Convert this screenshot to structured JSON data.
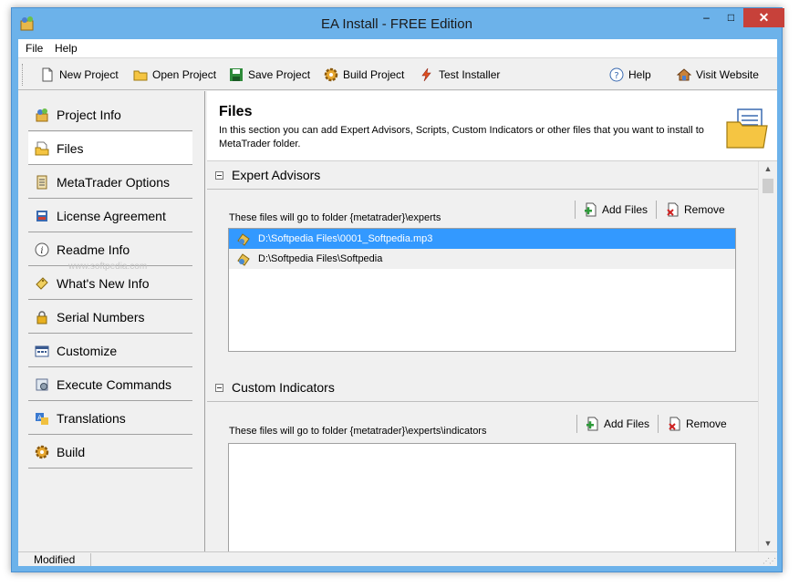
{
  "window": {
    "title": "EA Install - FREE Edition",
    "min_symbol": "–",
    "max_symbol": "□",
    "close_symbol": "✕"
  },
  "menu": {
    "items": [
      "File",
      "Help"
    ]
  },
  "toolbar": {
    "new_project": "New Project",
    "open_project": "Open Project",
    "save_project": "Save Project",
    "build_project": "Build Project",
    "test_installer": "Test Installer",
    "help": "Help",
    "visit_website": "Visit Website"
  },
  "sidebar": {
    "items": [
      {
        "label": "Project Info",
        "icon": "project-info-icon",
        "active": false
      },
      {
        "label": "Files",
        "icon": "files-icon",
        "active": true
      },
      {
        "label": "MetaTrader Options",
        "icon": "options-icon",
        "active": false
      },
      {
        "label": "License Agreement",
        "icon": "license-icon",
        "active": false
      },
      {
        "label": "Readme Info",
        "icon": "info-icon",
        "active": false
      },
      {
        "label": "What's New Info",
        "icon": "whats-new-icon",
        "active": false
      },
      {
        "label": "Serial Numbers",
        "icon": "lock-icon",
        "active": false
      },
      {
        "label": "Customize",
        "icon": "customize-icon",
        "active": false
      },
      {
        "label": "Execute Commands",
        "icon": "execute-icon",
        "active": false
      },
      {
        "label": "Translations",
        "icon": "translations-icon",
        "active": false
      },
      {
        "label": "Build",
        "icon": "build-icon",
        "active": false
      }
    ],
    "watermark": "www.softpedia.com"
  },
  "main": {
    "title": "Files",
    "description": "In this section you can add Expert Advisors, Scripts, Custom Indicators or other files that you want to install to MetaTrader folder.",
    "sections": [
      {
        "title": "Expert Advisors",
        "folder_note": "These files will go to folder {metatrader}\\experts",
        "add_label": "Add Files",
        "remove_label": "Remove",
        "files": [
          {
            "path": "D:\\Softpedia Files\\0001_Softpedia.mp3",
            "selected": true
          },
          {
            "path": "D:\\Softpedia Files\\Softpedia",
            "selected": false
          }
        ]
      },
      {
        "title": "Custom Indicators",
        "folder_note": "These files will go to folder {metatrader}\\experts\\indicators",
        "add_label": "Add Files",
        "remove_label": "Remove",
        "files": []
      }
    ]
  },
  "status": {
    "text": "Modified"
  },
  "colors": {
    "title_bar": "#6cb2ea",
    "close_button": "#c7413a",
    "selection": "#3399ff"
  }
}
